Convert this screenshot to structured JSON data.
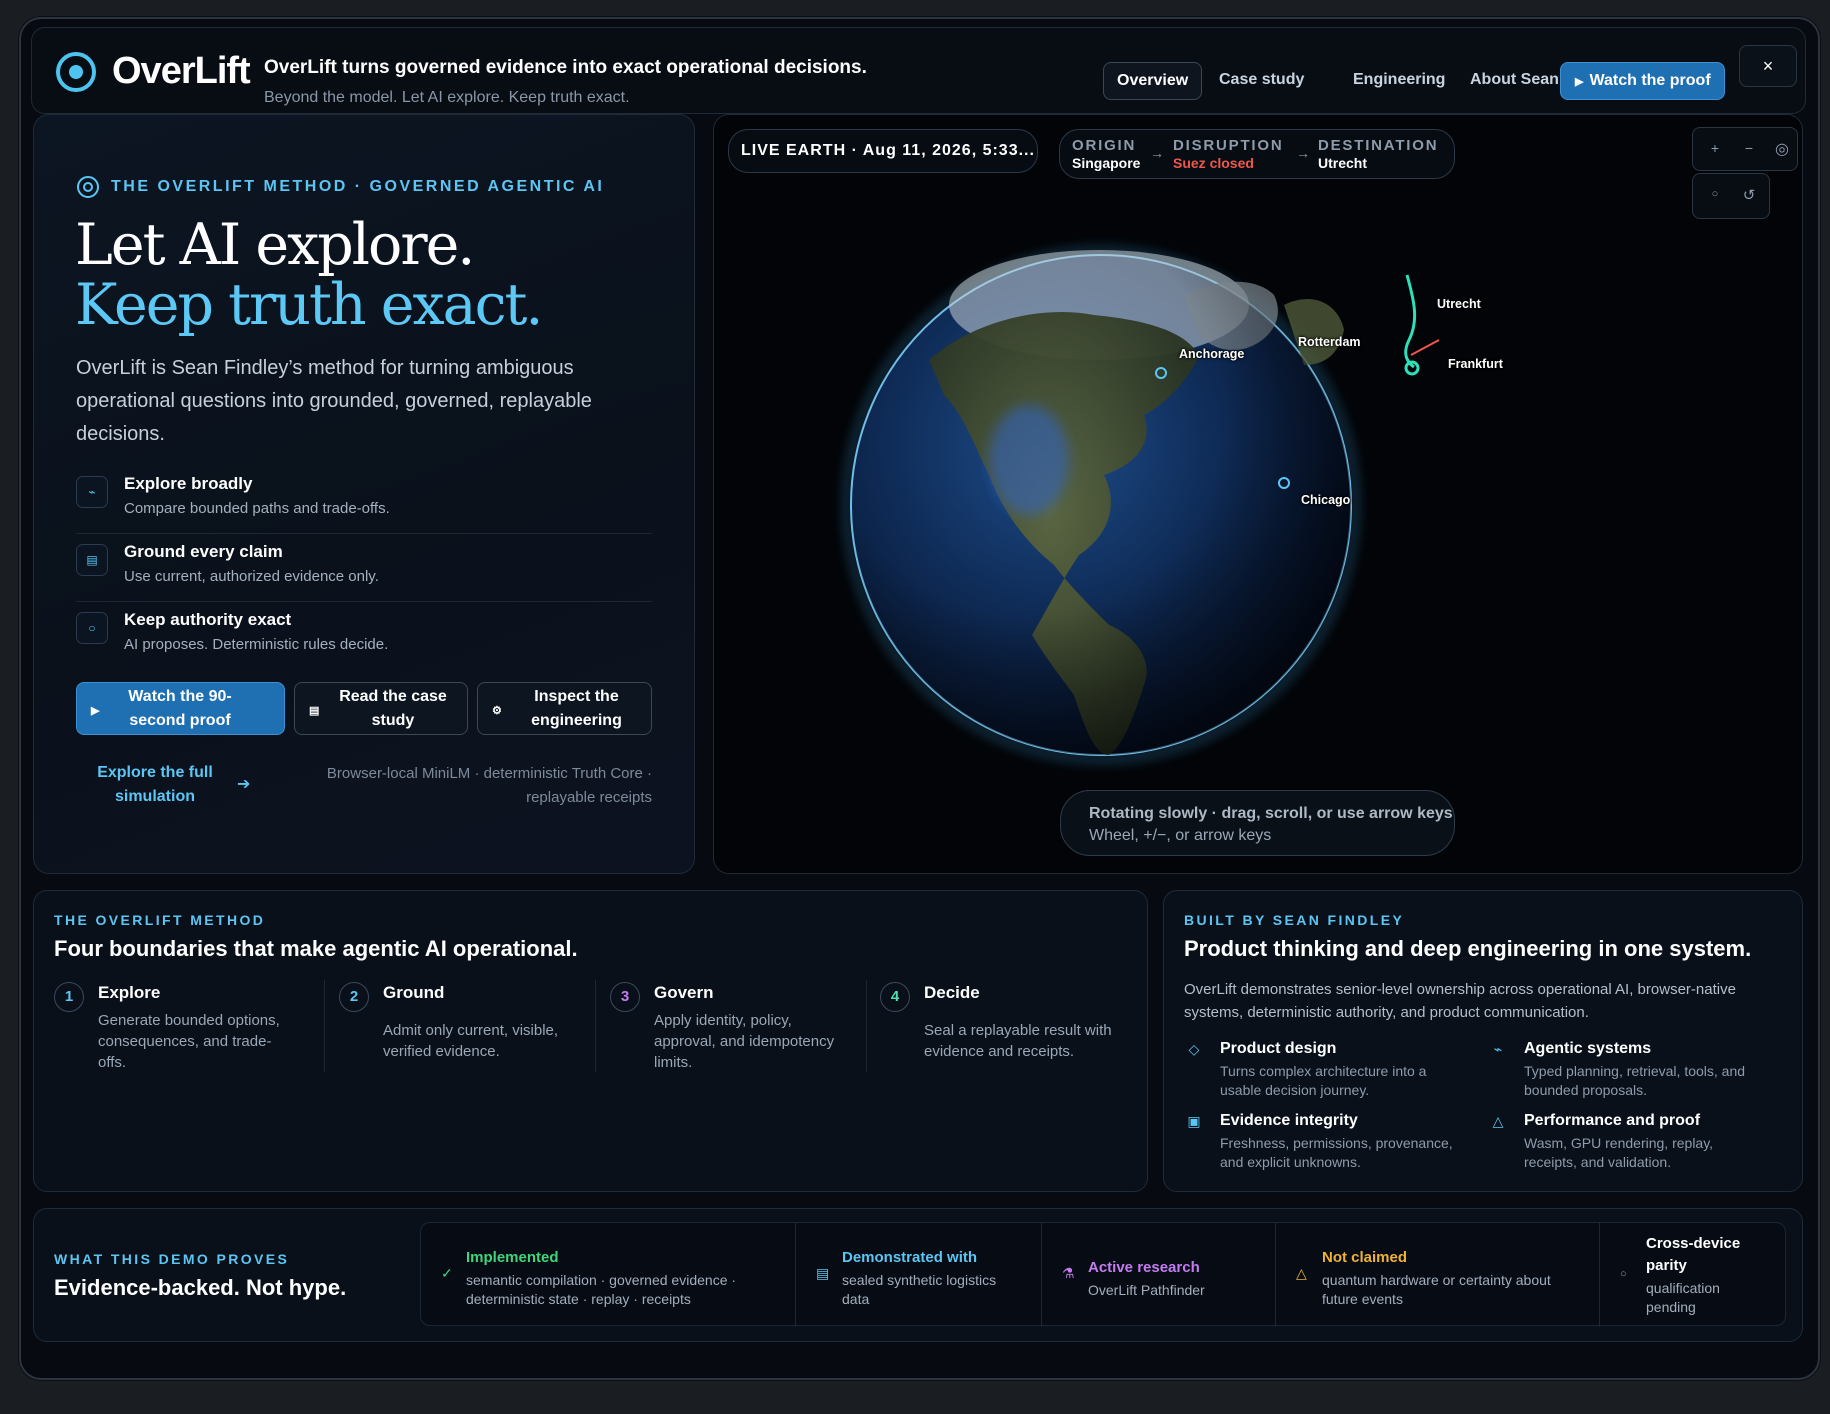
{
  "header": {
    "brand": "OverLift",
    "headline": "OverLift turns governed evidence into exact operational decisions.",
    "subline": "Beyond the model. Let AI explore. Keep truth exact.",
    "nav": [
      {
        "label": "Overview",
        "active": true
      },
      {
        "label": "Case study",
        "active": false
      },
      {
        "label": "Engineering",
        "active": false
      },
      {
        "label": "About Sean",
        "active": false
      }
    ],
    "cta_label": "Watch the proof",
    "close_label": "×"
  },
  "hero": {
    "tag": "THE OVERLIFT METHOD · GOVERNED AGENTIC AI",
    "title_line1": "Let AI explore.",
    "title_line2": "Keep truth exact.",
    "intro": "OverLift is Sean Findley’s method for turning ambiguous operational questions into grounded, governed, replayable decisions.",
    "features": [
      {
        "icon": "explore-icon",
        "title": "Explore broadly",
        "desc": "Compare bounded paths and trade-offs."
      },
      {
        "icon": "document-icon",
        "title": "Ground every claim",
        "desc": "Use current, authorized evidence only."
      },
      {
        "icon": "authority-icon",
        "title": "Keep authority exact",
        "desc": "AI proposes. Deterministic rules decide."
      }
    ],
    "buttons": {
      "proof": "Watch the 90-second proof",
      "case": "Read the case study",
      "engineering": "Inspect the engineering"
    },
    "explore_link": "Explore the full simulation",
    "footnote": "Browser-local MiniLM · deterministic Truth Core · replayable receipts"
  },
  "map": {
    "live_label": "LIVE EARTH · Aug 11, 2026, 5:33...",
    "route": {
      "origin_label": "ORIGIN",
      "origin_value": "Singapore",
      "disruption_label": "DISRUPTION",
      "disruption_value": "Suez closed",
      "destination_label": "DESTINATION",
      "destination_value": "Utrecht"
    },
    "controls": {
      "zoom_in": "+",
      "zoom_out": "−",
      "locate": "◎",
      "mode": "○",
      "reset": "↺"
    },
    "cities": [
      "Utrecht",
      "Rotterdam",
      "Anchorage",
      "Frankfurt",
      "Chicago"
    ],
    "hint_primary": "Rotating slowly · drag, scroll, or use arrow keys",
    "hint_secondary": "Wheel, +/−, or arrow keys",
    "colors": {
      "disruption": "#f0574a",
      "route": "#2ee0b8",
      "accent": "#5bc6f4"
    }
  },
  "method": {
    "tag": "THE OVERLIFT METHOD",
    "title": "Four boundaries that make agentic AI operational.",
    "steps": [
      {
        "num": "1",
        "title": "Explore",
        "desc": "Generate bounded options, consequences, and trade-offs.",
        "color": "#5bc6f4"
      },
      {
        "num": "2",
        "title": "Ground",
        "desc": "Admit only current, visible, verified evidence.",
        "color": "#5bc6f4"
      },
      {
        "num": "3",
        "title": "Govern",
        "desc": "Apply identity, policy, approval, and idempotency limits.",
        "color": "#c47cf0"
      },
      {
        "num": "4",
        "title": "Decide",
        "desc": "Seal a replayable result with evidence and receipts.",
        "color": "#4fe0b0"
      }
    ]
  },
  "builder": {
    "tag": "BUILT BY SEAN FINDLEY",
    "title": "Product thinking and deep engineering in one system.",
    "intro": "OverLift demonstrates senior-level ownership across operational AI, browser-native systems, deterministic authority, and product communication.",
    "items": [
      {
        "icon": "diamond-icon",
        "title": "Product design",
        "desc": "Turns complex architecture into a usable decision journey."
      },
      {
        "icon": "pulse-icon",
        "title": "Agentic systems",
        "desc": "Typed planning, retrieval, tools, and bounded proposals."
      },
      {
        "icon": "square-icon",
        "title": "Evidence integrity",
        "desc": "Freshness, permissions, provenance, and explicit unknowns."
      },
      {
        "icon": "triangle-icon",
        "title": "Performance and proof",
        "desc": "Wasm, GPU rendering, replay, receipts, and validation."
      }
    ]
  },
  "proves": {
    "tag": "WHAT THIS DEMO PROVES",
    "title": "Evidence-backed. Not hype.",
    "items": [
      {
        "icon": "✓",
        "title": "Implemented",
        "desc": "semantic compilation · governed evidence · deterministic state · replay · receipts",
        "color": "#3fd57a"
      },
      {
        "icon": "▤",
        "title": "Demonstrated with",
        "desc": "sealed synthetic logistics data",
        "color": "#5bc6f4"
      },
      {
        "icon": "⚗",
        "title": "Active research",
        "desc": "OverLift Pathfinder",
        "color": "#c47cf0"
      },
      {
        "icon": "△",
        "title": "Not claimed",
        "desc": "quantum hardware or certainty about future events",
        "color": "#f0b232"
      },
      {
        "icon": "○",
        "title": "Cross-device parity",
        "desc": "qualification pending",
        "color": "#ffffff"
      }
    ]
  }
}
